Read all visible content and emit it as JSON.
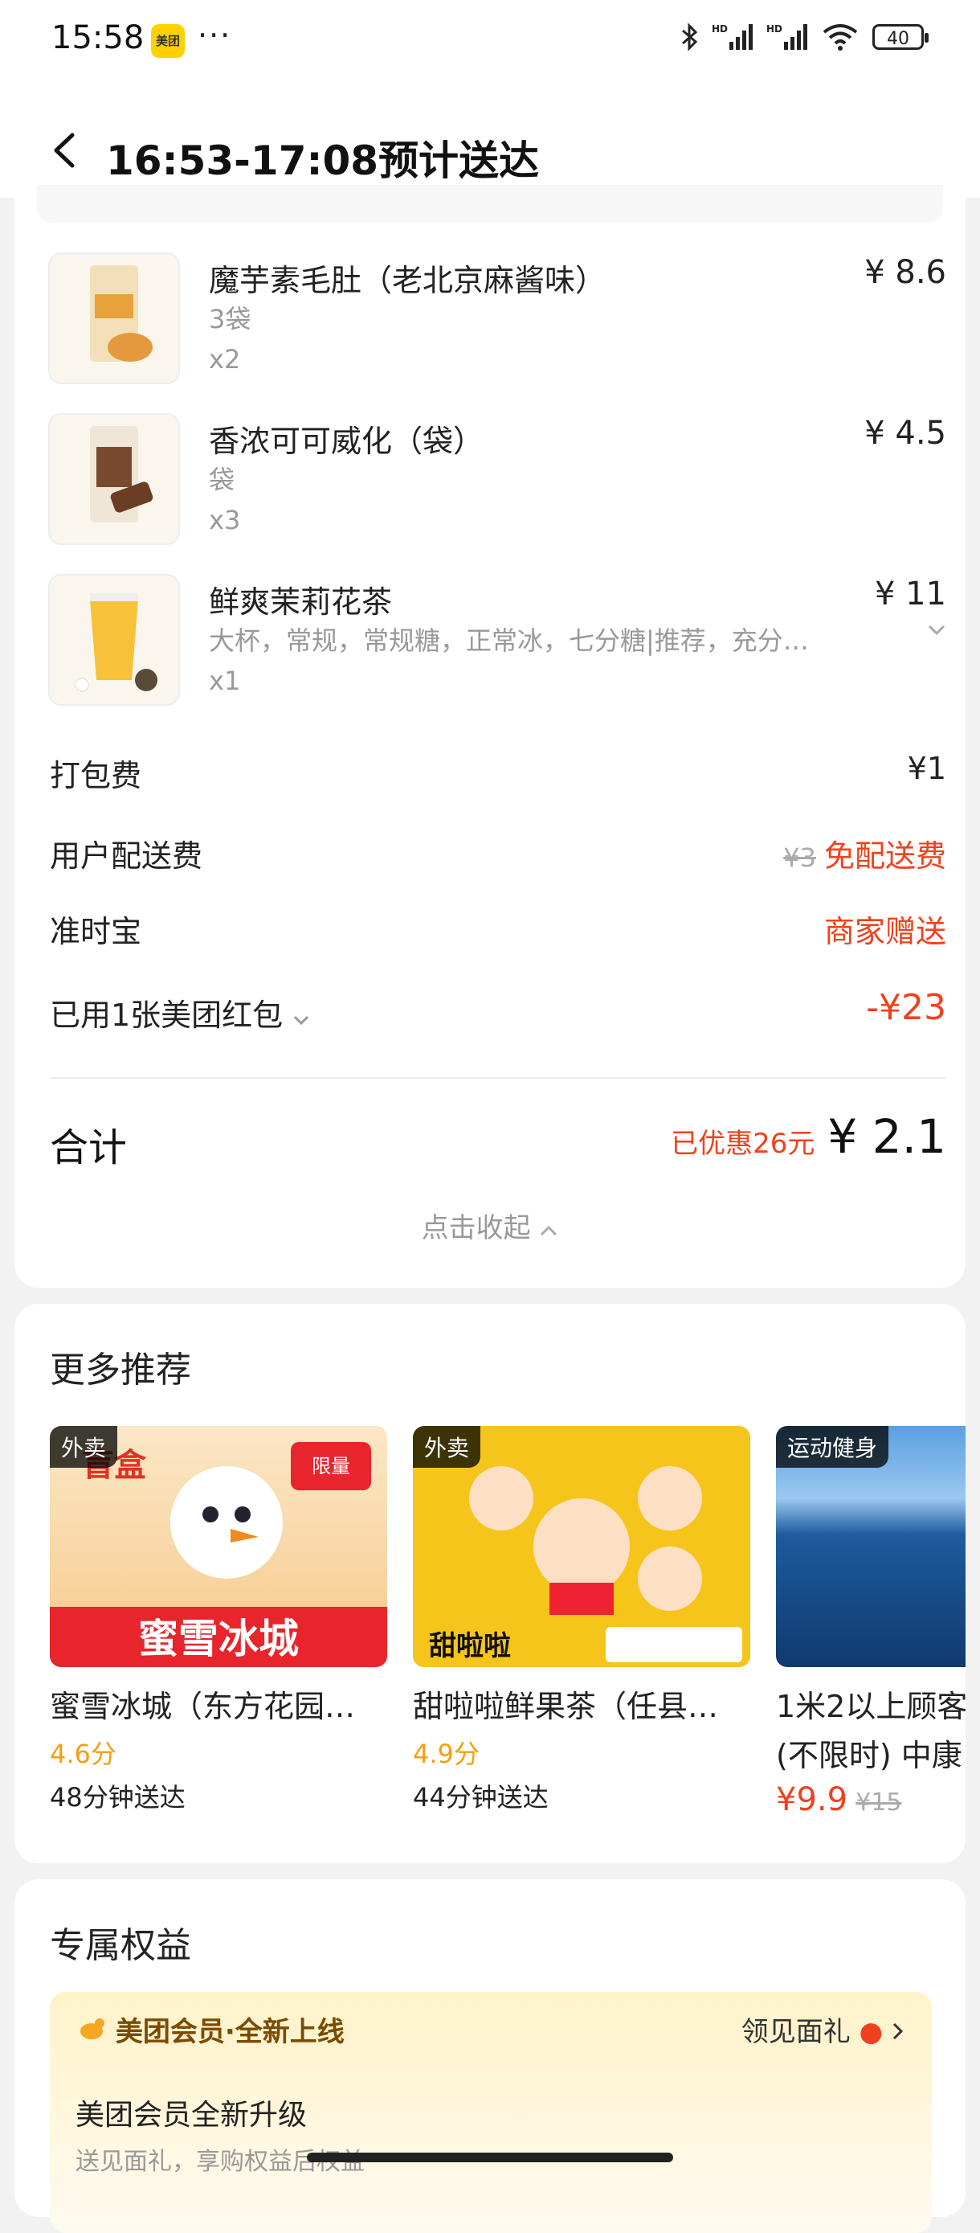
{
  "status_bar": {
    "time": "15:58",
    "app_badge": "美团",
    "more": "···",
    "battery": "40"
  },
  "header": {
    "title": "16:53-17:08预计送达"
  },
  "items": [
    {
      "name": "魔芋素毛肚（老北京麻酱味）",
      "spec": "3袋",
      "qty": "x2",
      "price": "¥ 8.6"
    },
    {
      "name": "香浓可可威化（袋）",
      "spec": "袋",
      "qty": "x3",
      "price": "¥ 4.5"
    },
    {
      "name": "鲜爽茉莉花茶",
      "spec": "大杯，常规，常规糖，正常冰，七分糖|推荐，充分…",
      "qty": "x1",
      "price": "¥ 11"
    }
  ],
  "fees": {
    "packing": {
      "label": "打包费",
      "value": "¥1"
    },
    "delivery": {
      "label": "用户配送费",
      "original": "¥3",
      "value": "免配送费"
    },
    "ontime": {
      "label": "准时宝",
      "value": "商家赠送"
    },
    "coupon": {
      "label": "已用1张美团红包",
      "value": "-¥23"
    }
  },
  "total": {
    "label": "合计",
    "discount": "已优惠26元",
    "amount": "¥ 2.1"
  },
  "collapse": "点击收起",
  "recommend": {
    "title": "更多推荐",
    "cards": [
      {
        "tag": "外卖",
        "name": "蜜雪冰城（东方花园…",
        "score": "4.6分",
        "eta": "48分钟送达",
        "img_text": "蜜雪冰城"
      },
      {
        "tag": "外卖",
        "name": "甜啦啦鲜果茶（任县…",
        "score": "4.9分",
        "eta": "44分钟送达",
        "img_text": "甜啦啦"
      },
      {
        "tag": "运动健身",
        "name": "1米2以上顾客",
        "name2": "(不限时) 中康",
        "price": "¥9.9",
        "orig_price": "¥15"
      }
    ]
  },
  "benefits": {
    "title": "专属权益",
    "head": "美团会员·全新上线",
    "link": "领见面礼",
    "text": "美团会员全新升级",
    "sub": "送见面礼，享购权益后权益"
  },
  "colors": {
    "accent_red": "#f0411e",
    "score_orange": "#f5a00e",
    "member_gold": "#ffd100"
  }
}
